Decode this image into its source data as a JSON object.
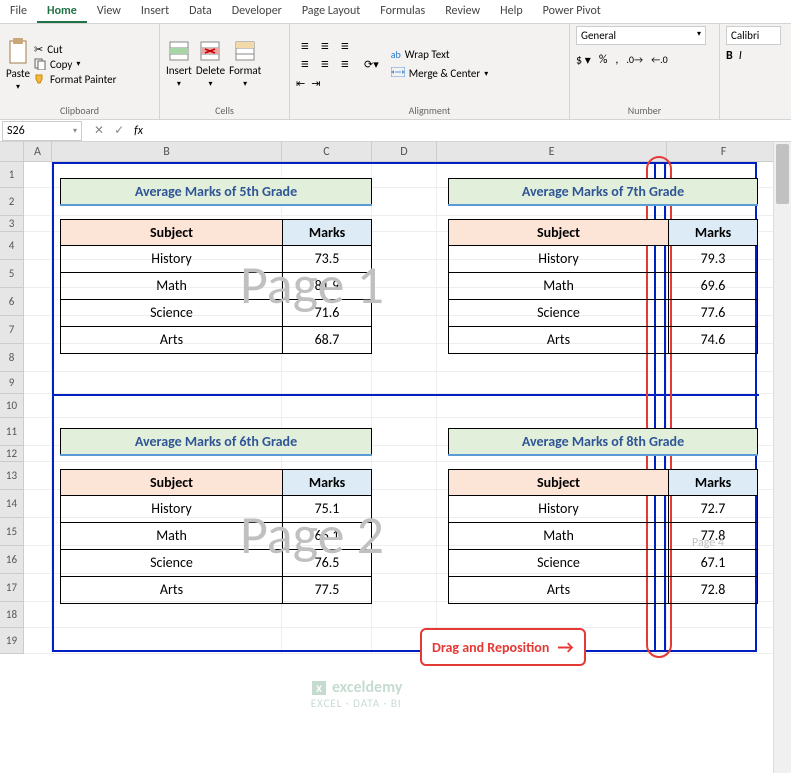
{
  "tabs": [
    "File",
    "Home",
    "View",
    "Insert",
    "Data",
    "Developer",
    "Page Layout",
    "Formulas",
    "Review",
    "Help",
    "Power Pivot"
  ],
  "active_tab": "Home",
  "clipboard": {
    "paste": "Paste",
    "cut": "Cut",
    "copy": "Copy",
    "fp": "Format Painter",
    "label": "Clipboard"
  },
  "cells": {
    "insert": "Insert",
    "delete": "Delete",
    "format": "Format",
    "label": "Cells"
  },
  "alignment": {
    "wrap": "Wrap Text",
    "merge": "Merge & Center",
    "label": "Alignment"
  },
  "number": {
    "sel": "General",
    "label": "Number"
  },
  "font": {
    "sel": "Calibri"
  },
  "namebox": "S26",
  "table5": {
    "title": "Average Marks of 5th Grade",
    "h1": "Subject",
    "h2": "Marks",
    "rows": [
      [
        "History",
        "73.5"
      ],
      [
        "Math",
        "81.9"
      ],
      [
        "Science",
        "71.6"
      ],
      [
        "Arts",
        "68.7"
      ]
    ]
  },
  "table7": {
    "title": "Average Marks of 7th Grade",
    "h1": "Subject",
    "h2": "Marks",
    "rows": [
      [
        "History",
        "79.3"
      ],
      [
        "Math",
        "69.6"
      ],
      [
        "Science",
        "77.6"
      ],
      [
        "Arts",
        "74.6"
      ]
    ]
  },
  "table6": {
    "title": "Average Marks of 6th Grade",
    "h1": "Subject",
    "h2": "Marks",
    "rows": [
      [
        "History",
        "75.1"
      ],
      [
        "Math",
        "66.1"
      ],
      [
        "Science",
        "76.5"
      ],
      [
        "Arts",
        "77.5"
      ]
    ]
  },
  "table8": {
    "title": "Average Marks of 8th Grade",
    "h1": "Subject",
    "h2": "Marks",
    "rows": [
      [
        "History",
        "72.7"
      ],
      [
        "Math",
        "77.8"
      ],
      [
        "Science",
        "67.1"
      ],
      [
        "Arts",
        "72.8"
      ]
    ]
  },
  "wm1": "Page 1",
  "wm2": "Page 2",
  "wm4": "Page 4",
  "callout": "Drag and Reposition",
  "cols": [
    "A",
    "B",
    "C",
    "D",
    "E",
    "F"
  ],
  "logo": {
    "name": "exceldemy",
    "tag": "EXCEL · DATA · BI"
  }
}
